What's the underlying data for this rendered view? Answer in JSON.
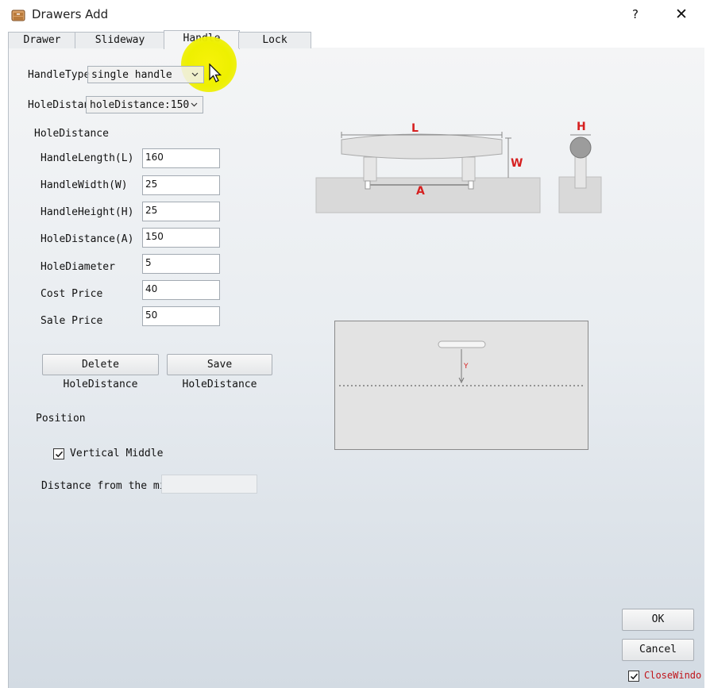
{
  "window": {
    "title": "Drawers Add",
    "help_label": "?",
    "close_label": "✕"
  },
  "tabs": [
    {
      "label": "Drawer"
    },
    {
      "label": "Slideway"
    },
    {
      "label": "Handle"
    },
    {
      "label": "Lock"
    }
  ],
  "active_tab": "Handle",
  "handle_type": {
    "label": "HandleType",
    "value": "single handle"
  },
  "hole_distance_select": {
    "label": "HoleDistan",
    "value": "holeDistance:150"
  },
  "group_title": "HoleDistance",
  "fields": [
    {
      "label": "HandleLength(L)",
      "value": "160"
    },
    {
      "label": "HandleWidth(W)",
      "value": "25"
    },
    {
      "label": "HandleHeight(H)",
      "value": "25"
    },
    {
      "label": "HoleDistance(A)",
      "value": "150"
    },
    {
      "label": "HoleDiameter",
      "value": "5"
    },
    {
      "label": "Cost Price",
      "value": "40"
    },
    {
      "label": "Sale Price",
      "value": "50"
    }
  ],
  "buttons": {
    "delete": "Delete HoleDistance",
    "save": "Save HoleDistance",
    "ok": "OK",
    "cancel": "Cancel"
  },
  "position": {
    "title": "Position",
    "vertical_middle": {
      "label": "Vertical Middle",
      "checked": true
    },
    "distance_label": "Distance from the mi",
    "distance_value": ""
  },
  "diagram": {
    "length_label": "L",
    "width_label": "W",
    "height_label": "H",
    "hole_label": "A",
    "y_label": "Y"
  },
  "close_window": {
    "label": "CloseWindo",
    "checked": true
  },
  "colors": {
    "accent_red": "#d62020",
    "highlight": "#f2ef00"
  }
}
